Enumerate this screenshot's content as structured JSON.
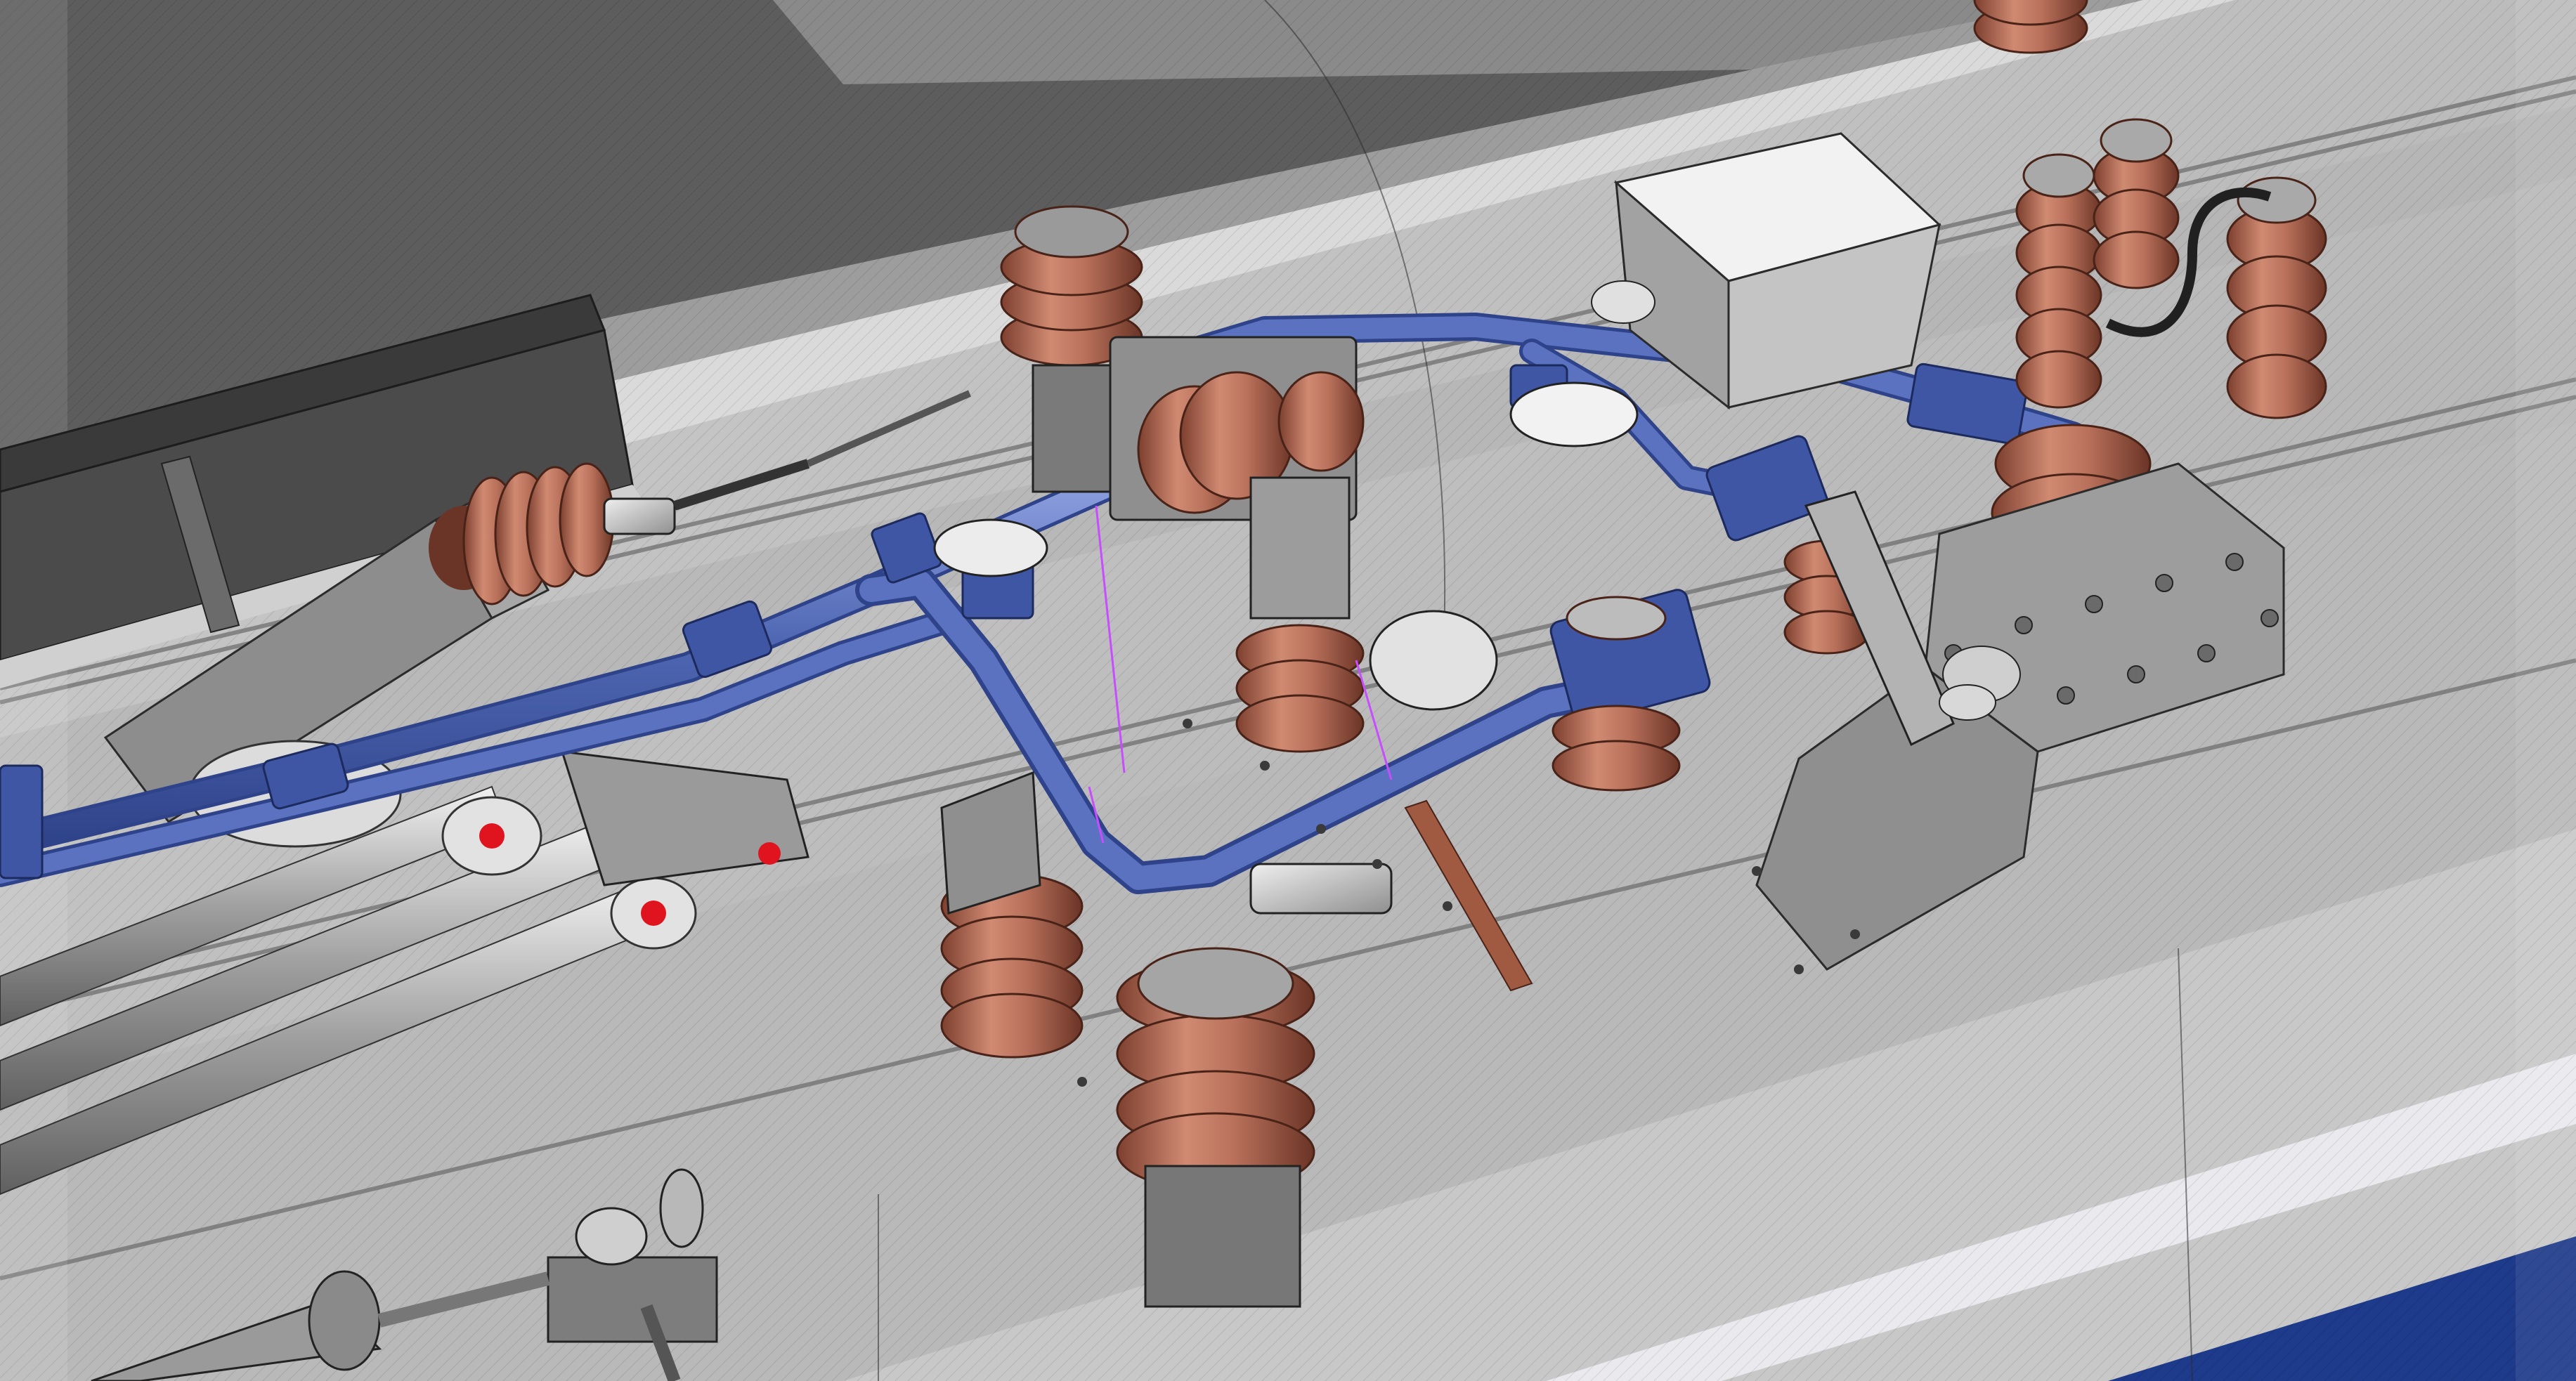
{
  "viewport": {
    "name": "3d-viewport",
    "render_style": "shaded-with-wireframe-edges"
  },
  "scene": {
    "subject": "locomotive-roof-high-voltage-equipment",
    "colors": {
      "background": "#5d5d5d",
      "roof_surface": "#bdbdbd",
      "roof_shadow": "#8a8a8a",
      "metal_light": "#d9d9d9",
      "metal_dark": "#6e6e6e",
      "insulator_copper": "#b8705a",
      "insulator_copper_dark": "#7d3f2f",
      "busbar_blue": "#4f67b3",
      "busbar_blue_dark": "#2f438a",
      "accent_red": "#e0141e",
      "accent_magenta": "#c84dff",
      "wire_black": "#202020",
      "body_blue_stripe": "#1e3a8a",
      "edge_line": "#2b2b2b"
    },
    "components": [
      "busbar-pipe-system",
      "stacked-insulators",
      "junction-box",
      "vacuum-circuit-breaker",
      "grounding-switch",
      "surge-arresters",
      "pantograph-base",
      "horn-assembly",
      "roof-hatch"
    ]
  }
}
